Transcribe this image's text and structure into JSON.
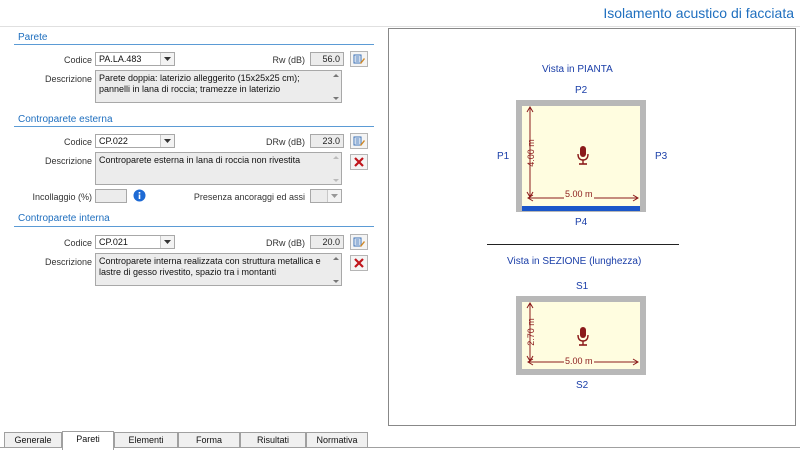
{
  "app": {
    "title": "Isolamento acustico di facciata"
  },
  "parete": {
    "section_title": "Parete",
    "codice_label": "Codice",
    "codice_value": "PA.LA.483",
    "value_label": "Rw (dB)",
    "value": "56.0",
    "descrizione_label": "Descrizione",
    "descrizione": "Parete doppia: laterizio alleggerito (15x25x25 cm); pannelli in lana di roccia; tramezze in laterizio"
  },
  "esterna": {
    "section_title": "Controparete esterna",
    "codice_label": "Codice",
    "codice_value": "CP.022",
    "value_label": "DRw (dB)",
    "value": "23.0",
    "descrizione_label": "Descrizione",
    "descrizione": "Controparete esterna in lana di roccia non rivestita",
    "incollaggio_label": "Incollaggio (%)",
    "incollaggio_value": "",
    "ancoraggi_label": "Presenza ancoraggi ed assi"
  },
  "interna": {
    "section_title": "Controparete interna",
    "codice_label": "Codice",
    "codice_value": "CP.021",
    "value_label": "DRw (dB)",
    "value": "20.0",
    "descrizione_label": "Descrizione",
    "descrizione": "Controparete interna realizzata con struttura metallica e lastre di gesso rivestito, spazio tra i montanti"
  },
  "diagram": {
    "plan_title": "Vista in PIANTA",
    "plan_top": "P2",
    "plan_left": "P1",
    "plan_right": "P3",
    "plan_bottom": "P4",
    "plan_depth": "4.00 m",
    "plan_width": "5.00 m",
    "section_title": "Vista in SEZIONE (lunghezza)",
    "section_top": "S1",
    "section_bottom": "S2",
    "section_height": "2.70 m",
    "section_width": "5.00 m",
    "accent_color": "#1a56c9",
    "room_fill": "#fffde0",
    "wall_color": "#b8b8b8",
    "mic_color": "#8b1a1a"
  },
  "tabs": [
    "Generale",
    "Pareti",
    "Elementi",
    "Forma",
    "Risultati",
    "Normativa"
  ],
  "active_tab": "Pareti",
  "icons": {
    "edit": "edit-list-icon",
    "delete": "delete-x-icon",
    "info": "info-icon",
    "mic": "microphone-icon"
  }
}
